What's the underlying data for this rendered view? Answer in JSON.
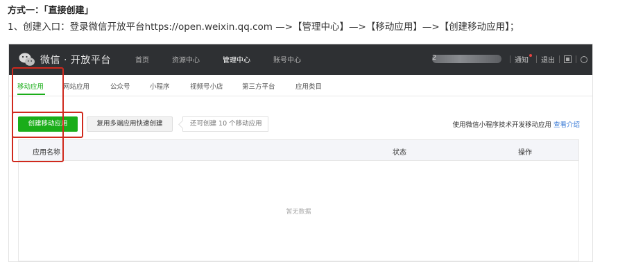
{
  "doc": {
    "heading": "方式一：「直接创建」",
    "step": "1、创建入口：登录微信开放平台https://open.weixin.qq.com  —>【管理中心】—>【移动应用】—>【创建移动应用】；"
  },
  "topbar": {
    "brand": "微信 · 开放平台",
    "nav": [
      "首页",
      "资源中心",
      "管理中心",
      "账号中心"
    ],
    "active_nav": "管理中心",
    "account_prefix": "2",
    "notify": "通知",
    "logout": "退出"
  },
  "subtabs": {
    "items": [
      "移动应用",
      "网站应用",
      "公众号",
      "小程序",
      "视频号小店",
      "第三方平台",
      "应用类目"
    ],
    "active": "移动应用"
  },
  "actions": {
    "create_label": "创建移动应用",
    "multi_label": "复用多端应用快速创建",
    "quota_tip": "还可创建 10 个移动应用",
    "hint_text": "使用微信小程序技术开发移动应用",
    "hint_link": "查看介绍"
  },
  "table": {
    "columns": [
      "应用名称",
      "状态",
      "操作"
    ],
    "empty_text": "暂无数据"
  },
  "colors": {
    "brand_green": "#1aad19",
    "topbar_bg": "#2e3033",
    "annotation_red": "#d0291d",
    "link_blue": "#3b7bd6"
  }
}
